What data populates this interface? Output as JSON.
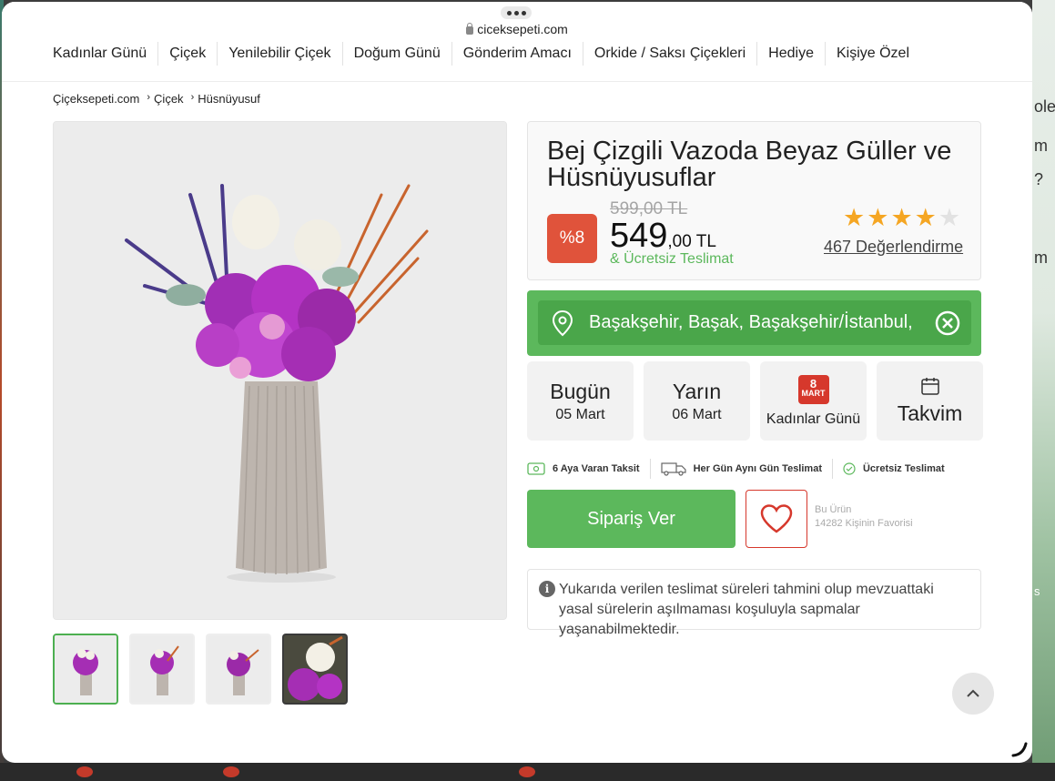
{
  "browser": {
    "url": "ciceksepeti.com"
  },
  "nav": {
    "items": [
      "Kadınlar Günü",
      "Çiçek",
      "Yenilebilir Çiçek",
      "Doğum Günü",
      "Gönderim Amacı",
      "Orkide / Saksı Çiçekleri",
      "Hediye",
      "Kişiye Özel"
    ]
  },
  "breadcrumb": [
    "Çiçeksepeti.com",
    "Çiçek",
    "Hüsnüyusuf"
  ],
  "product": {
    "title": "Bej Çizgili Vazoda Beyaz Güller ve Hüsnüyusuflar",
    "discount": "%8",
    "old_price": "599,00 TL",
    "price_int": "549",
    "price_dec": ",00 TL",
    "free_shipping": "& Ücretsiz Teslimat",
    "rating": 4,
    "rating_max": 5,
    "reviews": "467 Değerlendirme"
  },
  "location": {
    "value": "Başakşehir, Başak, Başakşehir/İstanbul,"
  },
  "delivery": {
    "today_label": "Bugün",
    "today_date": "05 Mart",
    "tomorrow_label": "Yarın",
    "tomorrow_date": "06 Mart",
    "special_badge_num": "8",
    "special_badge_text": "MART",
    "special_label": "Kadınlar Günü",
    "calendar_label": "Takvim"
  },
  "features": [
    "6 Aya Varan Taksit",
    "Her Gün Aynı Gün Teslimat",
    "Ücretsiz Teslimat"
  ],
  "order": {
    "button": "Sipariş Ver",
    "fav_line1": "Bu Ürün",
    "fav_line2": "14282 Kişinin Favorisi"
  },
  "notice": "Yukarıda verilen teslimat süreleri tahmini olup mevzuattaki yasal sürelerin aşılmaması koşuluyla sapmalar yaşanabilmektedir.",
  "background_text": [
    "olea",
    "m",
    "?",
    "m",
    "s"
  ],
  "colors": {
    "green": "#5cb85c",
    "red": "#e0533b",
    "star": "#f5a623"
  }
}
